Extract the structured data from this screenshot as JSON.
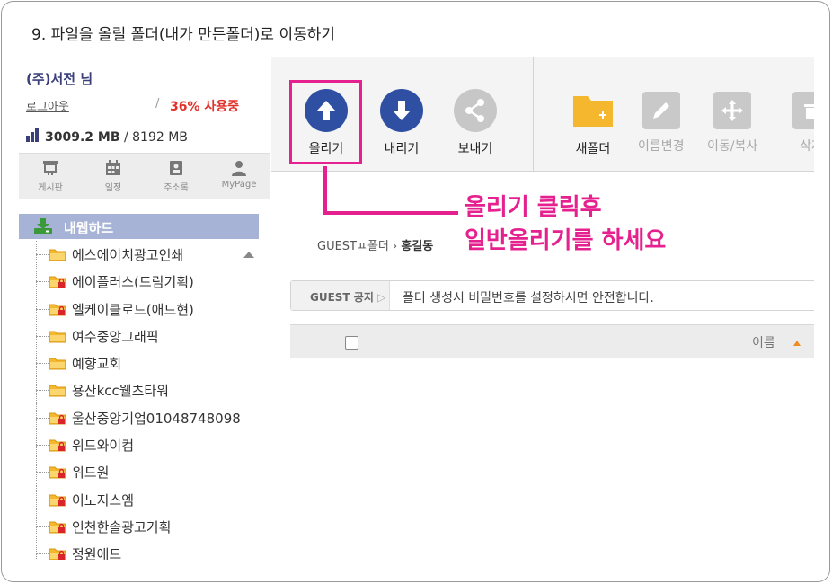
{
  "step_title": "9. 파일을 올릴 폴더(내가 만든폴더)로 이동하기",
  "user": {
    "name": "(주)서전 님",
    "logout": "로그아웃",
    "usage_sep": "/",
    "usage_percent": "36% 사용중",
    "storage_used": "3009.2 MB",
    "storage_sep": "/",
    "storage_total": "8192 MB"
  },
  "quick_menu": [
    {
      "label": "게시판",
      "icon": "board-icon"
    },
    {
      "label": "일정",
      "icon": "calendar-icon"
    },
    {
      "label": "주소록",
      "icon": "address-book-icon"
    },
    {
      "label": "MyPage",
      "icon": "person-icon"
    }
  ],
  "tree": {
    "root": "내웹하드",
    "items": [
      {
        "label": "에스에이치광고인쇄",
        "locked": false
      },
      {
        "label": "에이플러스(드림기획)",
        "locked": true
      },
      {
        "label": "엘케이클로드(애드현)",
        "locked": true
      },
      {
        "label": "여수중앙그래픽",
        "locked": false
      },
      {
        "label": "예향교회",
        "locked": false
      },
      {
        "label": "용산kcc웰츠타워",
        "locked": false
      },
      {
        "label": "울산중앙기업01048748098",
        "locked": true
      },
      {
        "label": "위드와이컴",
        "locked": true
      },
      {
        "label": "위드원",
        "locked": true
      },
      {
        "label": "이노지스엠",
        "locked": true
      },
      {
        "label": "인천한솔광고기획",
        "locked": true
      },
      {
        "label": "정원애드",
        "locked": true
      }
    ]
  },
  "toolbar": {
    "upload": "올리기",
    "download": "내리기",
    "send": "보내기",
    "new_folder": "새폴더",
    "rename": "이름변경",
    "move_copy": "이동/복사",
    "delete": "삭제"
  },
  "colors": {
    "upload": "#2f4fa3",
    "download": "#2f4fa3",
    "send": "#c7c7c7",
    "folder": "#f5b72e",
    "highlight": "#e4218f"
  },
  "annotation": {
    "line1": "올리기 클릭후",
    "line2": "일반올리기를 하세요"
  },
  "breadcrumb": {
    "parent": "GUESTㅍ폴더",
    "current": "홍길동"
  },
  "notice": {
    "tag": "GUEST 공지",
    "text": "폴더 생성시 비밀번호를 설정하시면 안전합니다."
  },
  "list": {
    "col_name": "이름"
  }
}
